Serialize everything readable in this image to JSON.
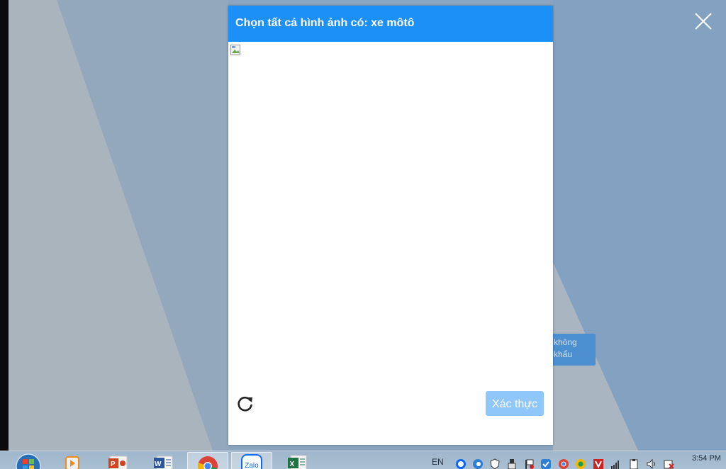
{
  "captcha": {
    "instruction": "Chọn tất cả hình ảnh có: xe môtô",
    "verify_label": "Xác thực",
    "refresh_icon": "refresh-icon",
    "image_icon": "broken-image-icon",
    "header_color": "#1d90f7",
    "verify_color": "#8fc7fb"
  },
  "overlay": {
    "close_icon": "close-icon"
  },
  "background_app": {
    "button_line1": "không",
    "button_line2": "khẩu"
  },
  "taskbar": {
    "language": "EN",
    "time": "3:54 PM",
    "apps": [
      {
        "name": "start-button",
        "icon": "windows-logo-icon"
      },
      {
        "name": "media-player",
        "icon": "media-player-icon"
      },
      {
        "name": "powerpoint",
        "icon": "powerpoint-icon"
      },
      {
        "name": "word",
        "icon": "word-icon"
      },
      {
        "name": "chrome",
        "icon": "chrome-icon"
      },
      {
        "name": "zalo",
        "icon": "zalo-icon",
        "label": "Zalo"
      },
      {
        "name": "excel",
        "icon": "excel-icon"
      }
    ],
    "tray": [
      "zalo-tray-icon",
      "edge-tray-icon",
      "shield-tray-icon",
      "usb-tray-icon",
      "flag-tray-icon",
      "update-tray-icon",
      "chrome-tray-icon",
      "color-tray-icon",
      "antivirus-tray-icon",
      "network-tray-icon",
      "clipboard-tray-icon",
      "volume-tray-icon",
      "power-tray-icon"
    ]
  }
}
